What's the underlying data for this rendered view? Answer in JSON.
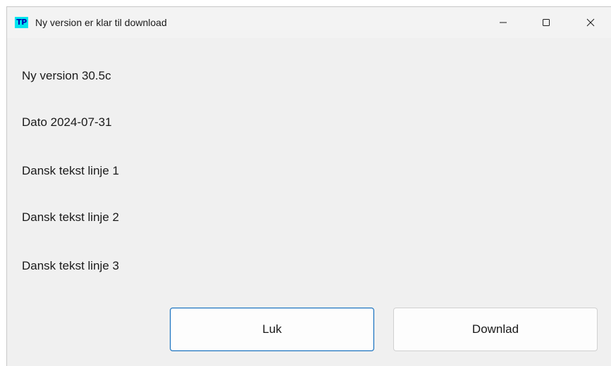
{
  "window": {
    "app_icon": "TP",
    "title": "Ny version er klar til download",
    "controls": {
      "minimize_icon": "minimize-icon",
      "maximize_icon": "maximize-icon",
      "close_icon": "close-icon"
    }
  },
  "content": {
    "lines": [
      "Ny version 30.5c",
      "Dato 2024-07-31",
      "Dansk tekst linje 1",
      "Dansk tekst linje 2",
      "Dansk tekst linje 3"
    ]
  },
  "buttons": {
    "close_label": "Luk",
    "download_label": "Downlad"
  },
  "colors": {
    "accent": "#0f6cbd",
    "icon_bg": "#00e5ee",
    "window_bg": "#f0f0f0"
  }
}
